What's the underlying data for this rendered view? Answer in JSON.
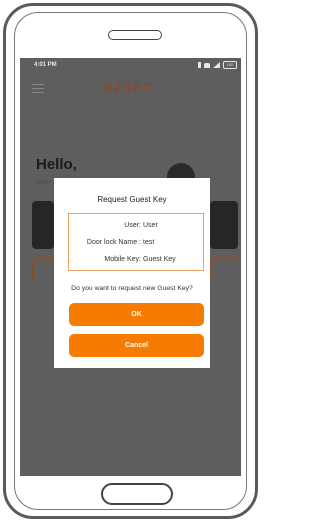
{
  "status_bar": {
    "time": "4:01 PM",
    "left_icons": [
      "settings-icon",
      "image-icon"
    ],
    "right_icons": [
      "bluetooth-icon",
      "wifi-icon",
      "signal-icon",
      "battery-icon"
    ],
    "battery": "100"
  },
  "header": {
    "logo": "EZSET."
  },
  "home": {
    "greeting": "Hello,",
    "subtitle": "User"
  },
  "dialog": {
    "title": "Request Guest Key",
    "rows": [
      {
        "label": "User:",
        "value": "User"
      },
      {
        "label": "Door lock Name :",
        "value": "test"
      },
      {
        "label": "Mobile Key:",
        "value": "Guest Key"
      }
    ],
    "question": "Do you want to request new Guest Key?",
    "ok_label": "OK",
    "cancel_label": "Cancel"
  },
  "colors": {
    "accent": "#f57c00",
    "border": "#e8a460",
    "overlay": "#5e5e5e"
  }
}
